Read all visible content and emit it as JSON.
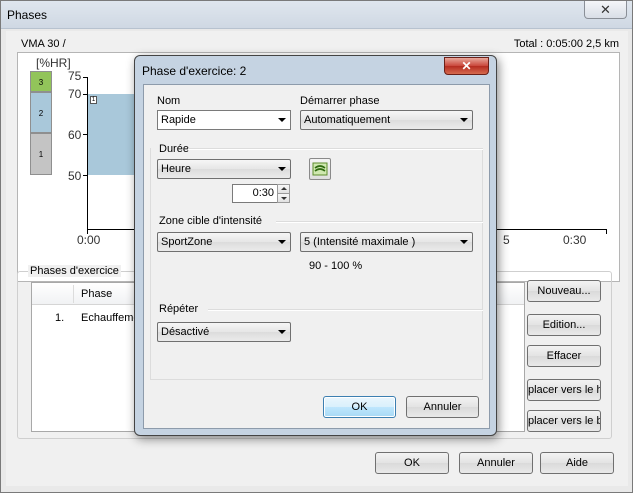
{
  "window": {
    "title": "Phases",
    "close_label": "✕"
  },
  "summary": {
    "vma": "VMA 30  /",
    "total": "Total : 0:05:00   2,5 km"
  },
  "chart": {
    "y_unit": "[%HR]",
    "y_ticks": [
      "75",
      "70",
      "60",
      "50"
    ],
    "x_ticks": [
      "0:00",
      "5",
      "0:30"
    ],
    "zones": [
      {
        "label": "3",
        "color": "#92c45a"
      },
      {
        "label": "2",
        "color": "#a9c8da"
      },
      {
        "label": "1",
        "color": "#c4c4c4"
      }
    ],
    "bar_marker": "1",
    "bar_color": "#a9c8da"
  },
  "phases_group": {
    "legend": "Phases d'exercice",
    "column_phase": "Phase",
    "rows": [
      {
        "num": "1.",
        "name": "Echauffeme"
      }
    ]
  },
  "side_buttons": {
    "nouveau": "Nouveau...",
    "edition": "Edition...",
    "effacer": "Effacer",
    "move_up": "placer vers le h",
    "move_down": "placer vers le b"
  },
  "bottom_buttons": {
    "ok": "OK",
    "annuler": "Annuler",
    "aide": "Aide"
  },
  "dialog": {
    "title": "Phase d'exercice: 2",
    "close_label": "✕",
    "nom_label": "Nom",
    "nom_value": "Rapide",
    "demarrer_label": "Démarrer phase",
    "demarrer_value": "Automatiquement",
    "duree_label": "Durée",
    "duree_type": "Heure",
    "duree_value": "0:30",
    "zone_label": "Zone cible d'intensité",
    "zone_type": "SportZone",
    "zone_value": "5 (Intensité maximale )",
    "zone_range": "90 - 100 %",
    "repeter_label": "Répéter",
    "repeter_value": "Désactivé",
    "ok": "OK",
    "annuler": "Annuler"
  }
}
